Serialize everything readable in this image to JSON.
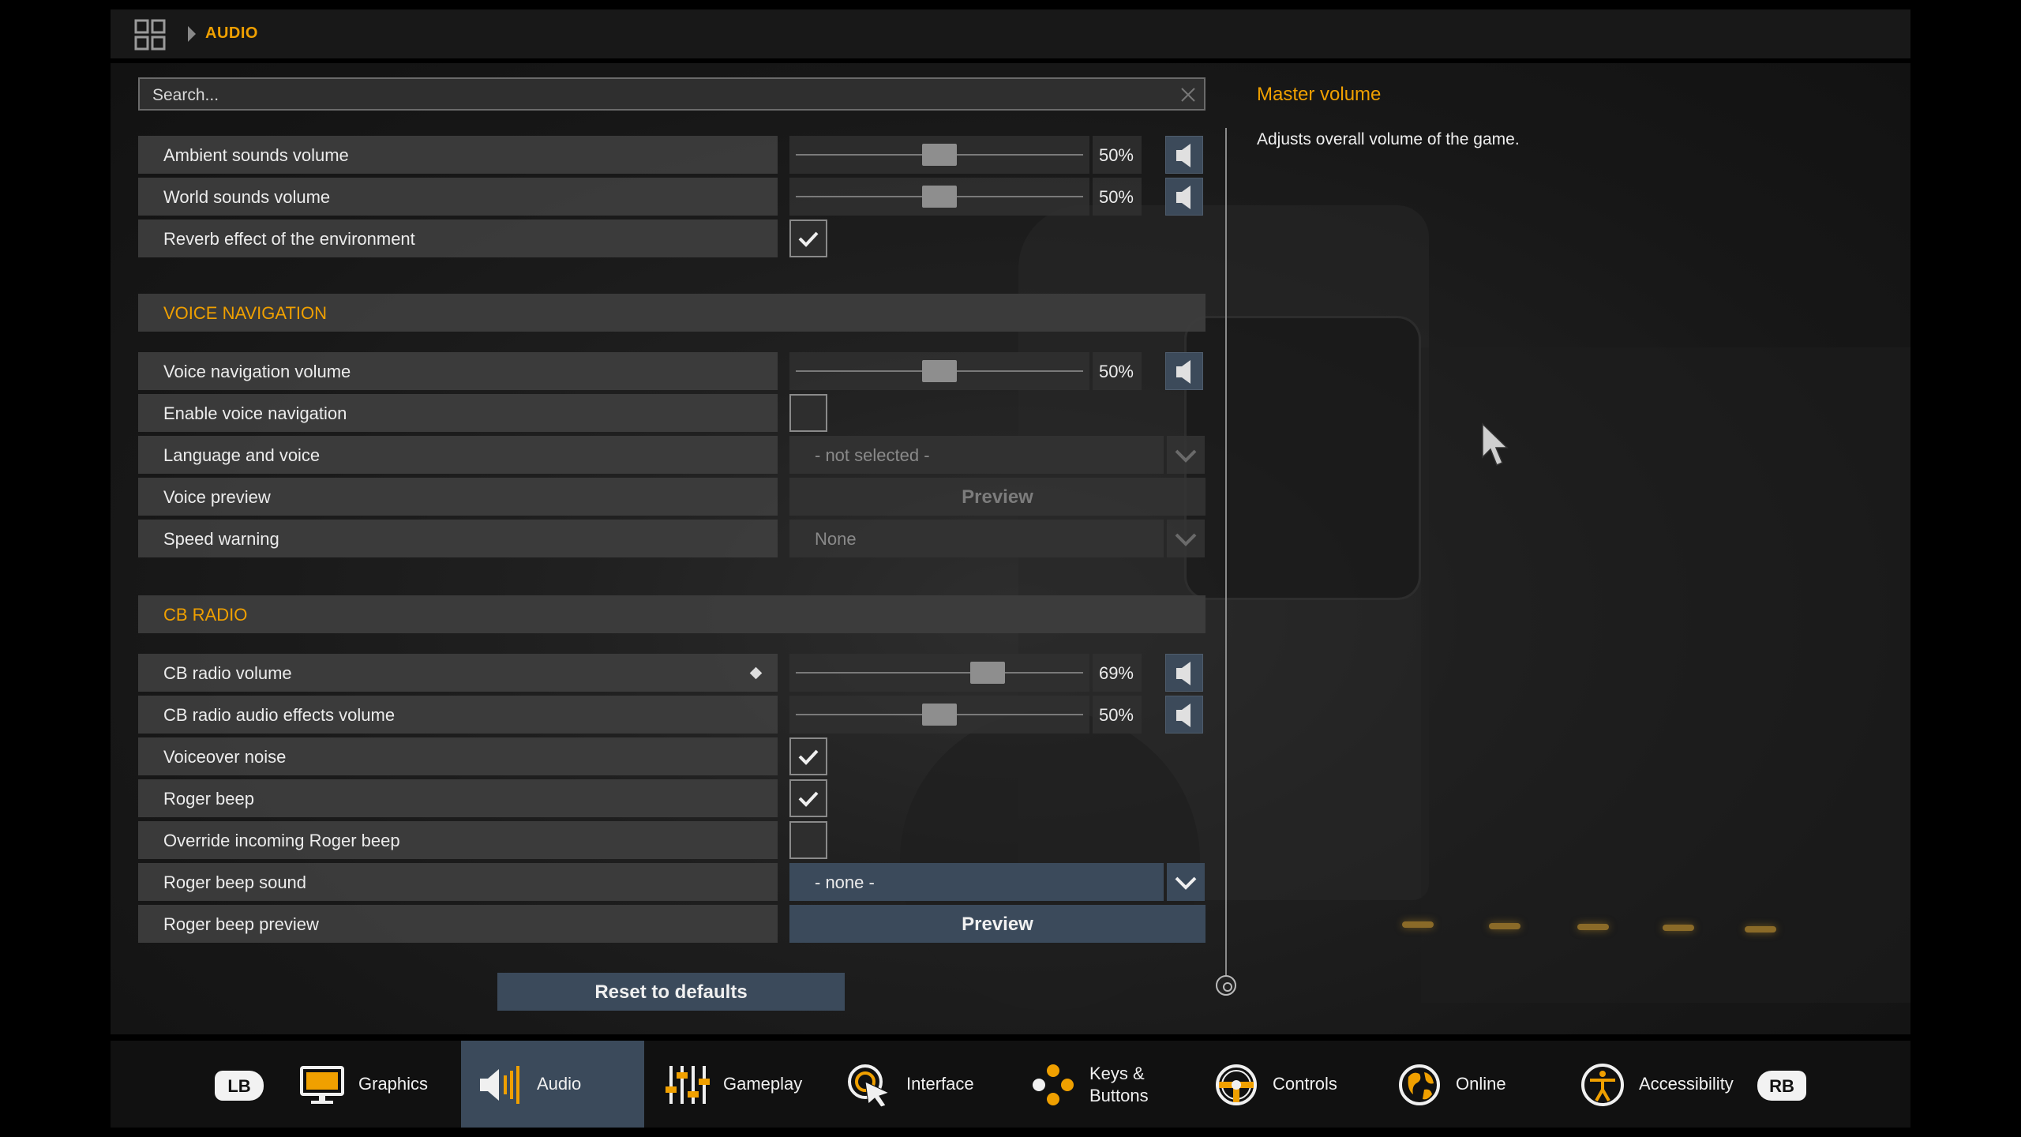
{
  "breadcrumb": {
    "section": "AUDIO"
  },
  "search": {
    "placeholder": "Search..."
  },
  "rows": {
    "ambient": {
      "label": "Ambient sounds volume",
      "value": "50%",
      "level": 0.5
    },
    "world": {
      "label": "World sounds volume",
      "value": "50%",
      "level": 0.5
    },
    "reverb": {
      "label": "Reverb effect of the environment",
      "checked": true
    },
    "voice_nav_header": "VOICE NAVIGATION",
    "voice_nav_volume": {
      "label": "Voice navigation volume",
      "value": "50%",
      "level": 0.5
    },
    "enable_voice_nav": {
      "label": "Enable voice navigation",
      "checked": false
    },
    "language_voice": {
      "label": "Language and voice",
      "value": "- not selected -"
    },
    "voice_preview": {
      "label": "Voice preview",
      "button": "Preview"
    },
    "speed_warning": {
      "label": "Speed warning",
      "value": "None"
    },
    "cb_radio_header": "CB RADIO",
    "cb_volume": {
      "label": "CB radio volume",
      "value": "69%",
      "level": 0.69
    },
    "cb_effects": {
      "label": "CB radio audio effects volume",
      "value": "50%",
      "level": 0.5
    },
    "voiceover_noise": {
      "label": "Voiceover noise",
      "checked": true
    },
    "roger_beep": {
      "label": "Roger beep",
      "checked": true
    },
    "override_roger": {
      "label": "Override incoming Roger beep",
      "checked": false
    },
    "roger_sound": {
      "label": "Roger beep sound",
      "value": "- none -"
    },
    "roger_preview": {
      "label": "Roger beep preview",
      "button": "Preview"
    }
  },
  "reset": {
    "label": "Reset to defaults"
  },
  "description": {
    "title": "Master volume",
    "text": "Adjusts overall volume of the game."
  },
  "bottom_nav": {
    "left_bumper": "LB",
    "right_bumper": "RB",
    "tabs": [
      {
        "label": "Graphics",
        "icon": "monitor-icon"
      },
      {
        "label": "Audio",
        "icon": "speaker-icon",
        "active": true
      },
      {
        "label": "Gameplay",
        "icon": "sliders-icon"
      },
      {
        "label": "Interface",
        "icon": "pointer-icon"
      },
      {
        "label": "Keys &\nButtons",
        "label_line1": "Keys &",
        "label_line2": "Buttons",
        "icon": "buttons-icon"
      },
      {
        "label": "Controls",
        "icon": "steering-wheel-icon"
      },
      {
        "label": "Online",
        "icon": "globe-icon"
      },
      {
        "label": "Accessibility",
        "icon": "accessibility-icon"
      }
    ]
  },
  "colors": {
    "accent": "#f0a000",
    "active_tab": "#3b4a5b",
    "row_bg": "#3e3e3e"
  }
}
